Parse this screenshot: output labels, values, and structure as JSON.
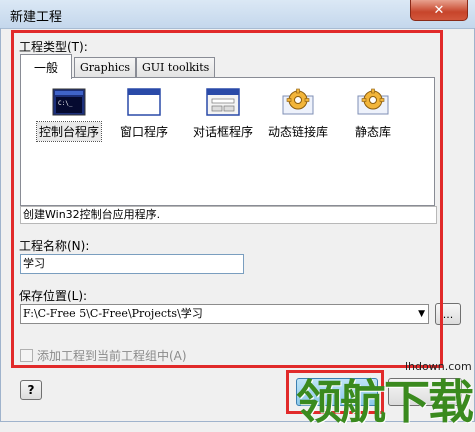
{
  "window": {
    "title": "新建工程",
    "close_glyph": "✕"
  },
  "project_types": {
    "label": "工程类型(T):",
    "tabs": [
      {
        "label": "一般",
        "active": true
      },
      {
        "label": "Graphics",
        "active": false
      },
      {
        "label": "GUI toolkits",
        "active": false
      }
    ],
    "items": [
      {
        "label": "控制台程序",
        "icon": "console-app-icon",
        "selected": true
      },
      {
        "label": "窗口程序",
        "icon": "window-app-icon",
        "selected": false
      },
      {
        "label": "对话框程序",
        "icon": "dialog-app-icon",
        "selected": false
      },
      {
        "label": "动态链接库",
        "icon": "dll-gear-icon",
        "selected": false
      },
      {
        "label": "静态库",
        "icon": "static-lib-gear-icon",
        "selected": false
      }
    ],
    "description": "创建Win32控制台应用程序."
  },
  "project_name": {
    "label": "工程名称(N):",
    "value": "学习"
  },
  "save_location": {
    "label": "保存位置(L):",
    "value": "F:\\C-Free 5\\C-Free\\Projects\\学习",
    "browse_label": "..."
  },
  "add_to_workspace": {
    "label": "添加工程到当前工程组中(A)",
    "checked": false,
    "enabled": false
  },
  "help_button": {
    "label": "?"
  },
  "watermark": {
    "text": "领航下载",
    "url": "lhdown.com"
  },
  "colors": {
    "highlight_box": "#e12a2a",
    "watermark": "#3a8a1e"
  }
}
